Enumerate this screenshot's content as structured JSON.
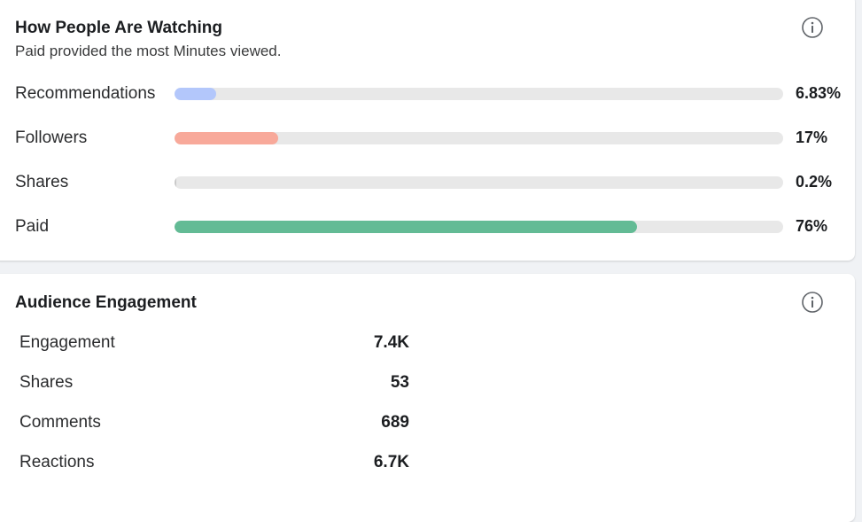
{
  "watching": {
    "title": "How People Are Watching",
    "subtitle": "Paid provided the most Minutes viewed.",
    "info_icon": "info-icon",
    "sources": [
      {
        "label": "Recommendations",
        "value_text": "6.83%",
        "fraction": 0.0683,
        "color": "#b3c7fb"
      },
      {
        "label": "Followers",
        "value_text": "17%",
        "fraction": 0.17,
        "color": "#f8a99a"
      },
      {
        "label": "Shares",
        "value_text": "0.2%",
        "fraction": 0.002,
        "color": "#c9c9c9"
      },
      {
        "label": "Paid",
        "value_text": "76%",
        "fraction": 0.76,
        "color": "#63bb95"
      }
    ]
  },
  "engagement": {
    "title": "Audience Engagement",
    "info_icon": "info-icon",
    "stats": [
      {
        "label": "Engagement",
        "value": "7.4K"
      },
      {
        "label": "Shares",
        "value": "53"
      },
      {
        "label": "Comments",
        "value": "689"
      },
      {
        "label": "Reactions",
        "value": "6.7K"
      }
    ]
  }
}
